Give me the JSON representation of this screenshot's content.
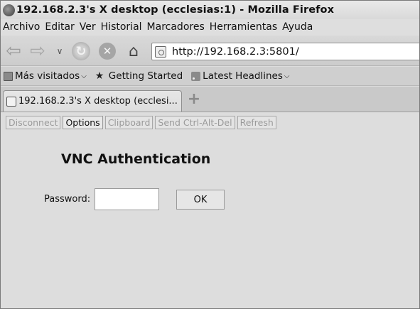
{
  "window": {
    "title": "192.168.2.3's X desktop (ecclesias:1) - Mozilla Firefox"
  },
  "menu": {
    "items": [
      "Archivo",
      "Editar",
      "Ver",
      "Historial",
      "Marcadores",
      "Herramientas",
      "Ayuda"
    ]
  },
  "navigation": {
    "url": "http://192.168.2.3:5801/"
  },
  "bookmarks": {
    "items": [
      {
        "label": "Más visitados",
        "icon": "folder-icon",
        "has_dropdown": true
      },
      {
        "label": "Getting Started",
        "icon": "firefox-icon",
        "has_dropdown": false
      },
      {
        "label": "Latest Headlines",
        "icon": "rss-icon",
        "has_dropdown": true
      }
    ]
  },
  "tabs": {
    "items": [
      {
        "label": "192.168.2.3's X desktop (ecclesi..."
      }
    ]
  },
  "applet": {
    "buttons": [
      {
        "label": "Disconnect",
        "enabled": false
      },
      {
        "label": "Options",
        "enabled": true
      },
      {
        "label": "Clipboard",
        "enabled": false
      },
      {
        "label": "Send Ctrl-Alt-Del",
        "enabled": false
      },
      {
        "label": "Refresh",
        "enabled": false
      }
    ],
    "heading": "VNC Authentication",
    "password_label": "Password:",
    "password_value": "",
    "ok_label": "OK"
  }
}
